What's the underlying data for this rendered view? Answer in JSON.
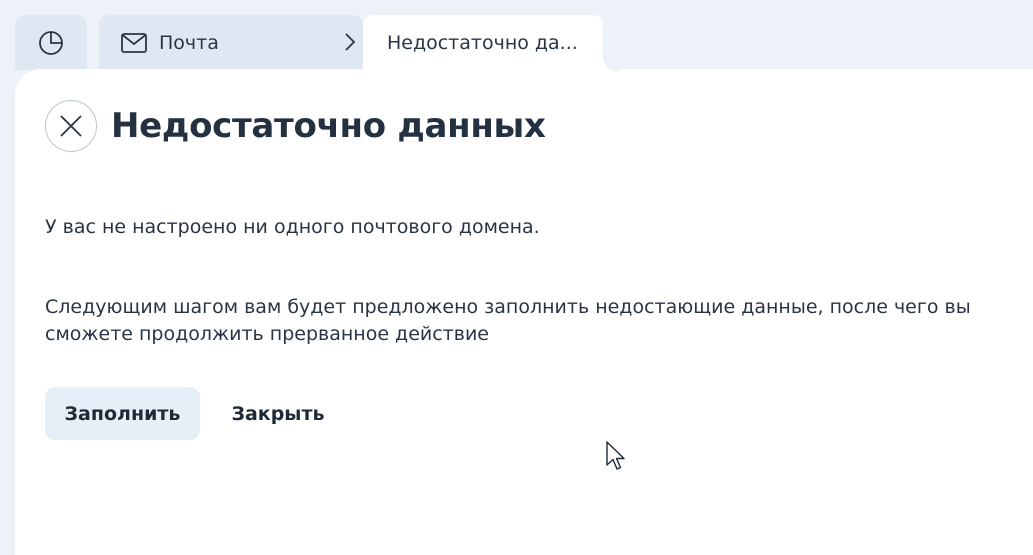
{
  "tabs": {
    "home_icon": "pie-chart-icon",
    "mail_icon": "envelope-icon",
    "mail_label": "Почта",
    "active_label": "Недостаточно да..."
  },
  "dialog": {
    "title": "Недостаточно данных",
    "close_icon": "close-icon",
    "message_1": "У вас не настроено ни одного почтового домена.",
    "message_2": "Следующим шагом вам будет предложено заполнить недостающие данные, после чего вы сможете продолжить прерванное действие",
    "primary_button": "Заполнить",
    "secondary_button": "Закрыть"
  },
  "colors": {
    "background": "#edf2f8",
    "tab_inactive": "#dfe8f2",
    "panel": "#ffffff",
    "primary_button_bg": "#e6eef7",
    "text": "#1f2a37"
  }
}
